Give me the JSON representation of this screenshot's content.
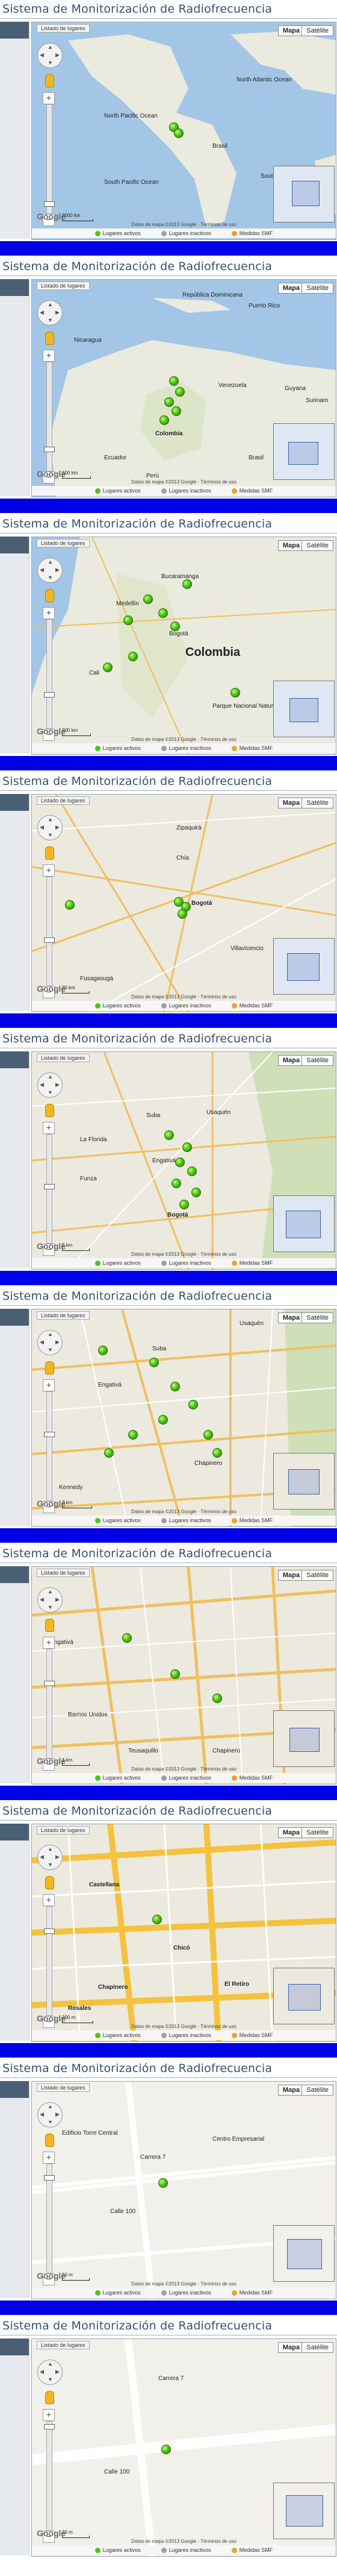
{
  "app_title": "Sistema de Monitorización de Radiofrecuencia",
  "map_ui": {
    "tab_label": "Listado de lugares",
    "type_map": "Mapa",
    "type_satellite": "Satélite",
    "legend_active": "Lugares activos",
    "legend_inactive": "Lugares inactivos",
    "legend_measurements": "Medidas SMF",
    "attribution": "Datos de mapa ©2013 Google · Términos de uso",
    "google": "Google"
  },
  "colors": {
    "title": "#384f74",
    "band": "#0000e6",
    "pin_active": "#4fc414",
    "water": "#a3c6e6",
    "land": "#eaeadf"
  },
  "panels": [
    {
      "scale": "2000 km",
      "labels": [
        "North Pacific Ocean",
        "South Pacific Ocean",
        "North Atlantic Ocean",
        "South Atlantic Ocean",
        "Brasil"
      ]
    },
    {
      "scale": "500 km",
      "labels": [
        "República Dominicana",
        "Puerto Rico",
        "Nicaragua",
        "Colombia",
        "Venezuela",
        "Guyana",
        "Surinam",
        "Ecuador",
        "Perú",
        "Brasil"
      ]
    },
    {
      "scale": "200 km",
      "labels": [
        "Bucaramanga",
        "Medellín",
        "Colombia",
        "Bogotá",
        "Cali",
        "Parque Nacional Natural Serranía"
      ]
    },
    {
      "scale": "20 km",
      "labels": [
        "Fusagasugá",
        "Bogotá",
        "Villavicencio",
        "Zipaquirá",
        "Chía"
      ]
    },
    {
      "scale": "5 km",
      "labels": [
        "Usaquén",
        "Suba",
        "Engativá",
        "Bogotá",
        "La Florida",
        "Funza"
      ]
    },
    {
      "scale": "2 km",
      "labels": [
        "Usaquén",
        "Suba",
        "Engativá",
        "Chapinero",
        "Kennedy"
      ]
    },
    {
      "scale": "1 km",
      "labels": [
        "Barrios Unidos",
        "Chapinero",
        "Teusaquillo",
        "Engativá"
      ]
    },
    {
      "scale": "200 m",
      "labels": [
        "Castellana",
        "Chicó",
        "Chapinero",
        "El Retiro",
        "Rosales"
      ]
    },
    {
      "scale": "50 m",
      "labels": [
        "Edificio Torre Central",
        "Calle 100",
        "Carrera 7",
        "Centro Empresarial"
      ]
    },
    {
      "scale": "20 m",
      "labels": [
        "Calle 100",
        "Carrera 7"
      ]
    }
  ]
}
